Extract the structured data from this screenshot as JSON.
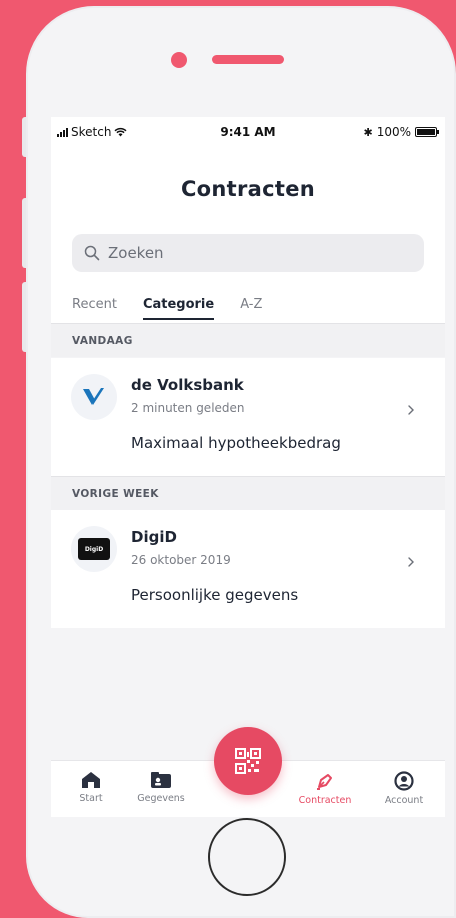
{
  "status_bar": {
    "carrier": "Sketch",
    "time": "9:41 AM",
    "battery": "100%"
  },
  "header": {
    "title": "Contracten"
  },
  "search": {
    "placeholder": "Zoeken"
  },
  "tabs": [
    {
      "label": "Recent",
      "active": false
    },
    {
      "label": "Categorie",
      "active": true
    },
    {
      "label": "A-Z",
      "active": false
    }
  ],
  "sections": [
    {
      "label": "VANDAAG",
      "items": [
        {
          "name": "de Volksbank",
          "time": "2 minuten geleden",
          "description": "Maximaal hypotheekbedrag",
          "logo_icon": "volksbank-logo"
        }
      ]
    },
    {
      "label": "VORIGE WEEK",
      "items": [
        {
          "name": "DigiD",
          "time": "26 oktober 2019",
          "description": "Persoonlijke gegevens",
          "logo_icon": "digid-logo",
          "logo_text": "DigiD"
        }
      ]
    }
  ],
  "bottom_nav": [
    {
      "label": "Start",
      "icon": "home-icon",
      "active": false
    },
    {
      "label": "Gegevens",
      "icon": "id-card-icon",
      "active": false
    },
    {
      "label": "Contracten",
      "icon": "pen-icon",
      "active": true
    },
    {
      "label": "Account",
      "icon": "user-icon",
      "active": false
    }
  ],
  "fab": {
    "icon": "qr-code-icon"
  },
  "colors": {
    "accent": "#e64a63",
    "background": "#f0586f",
    "text_dark": "#1e2533",
    "volksbank_blue": "#1b75bb"
  }
}
